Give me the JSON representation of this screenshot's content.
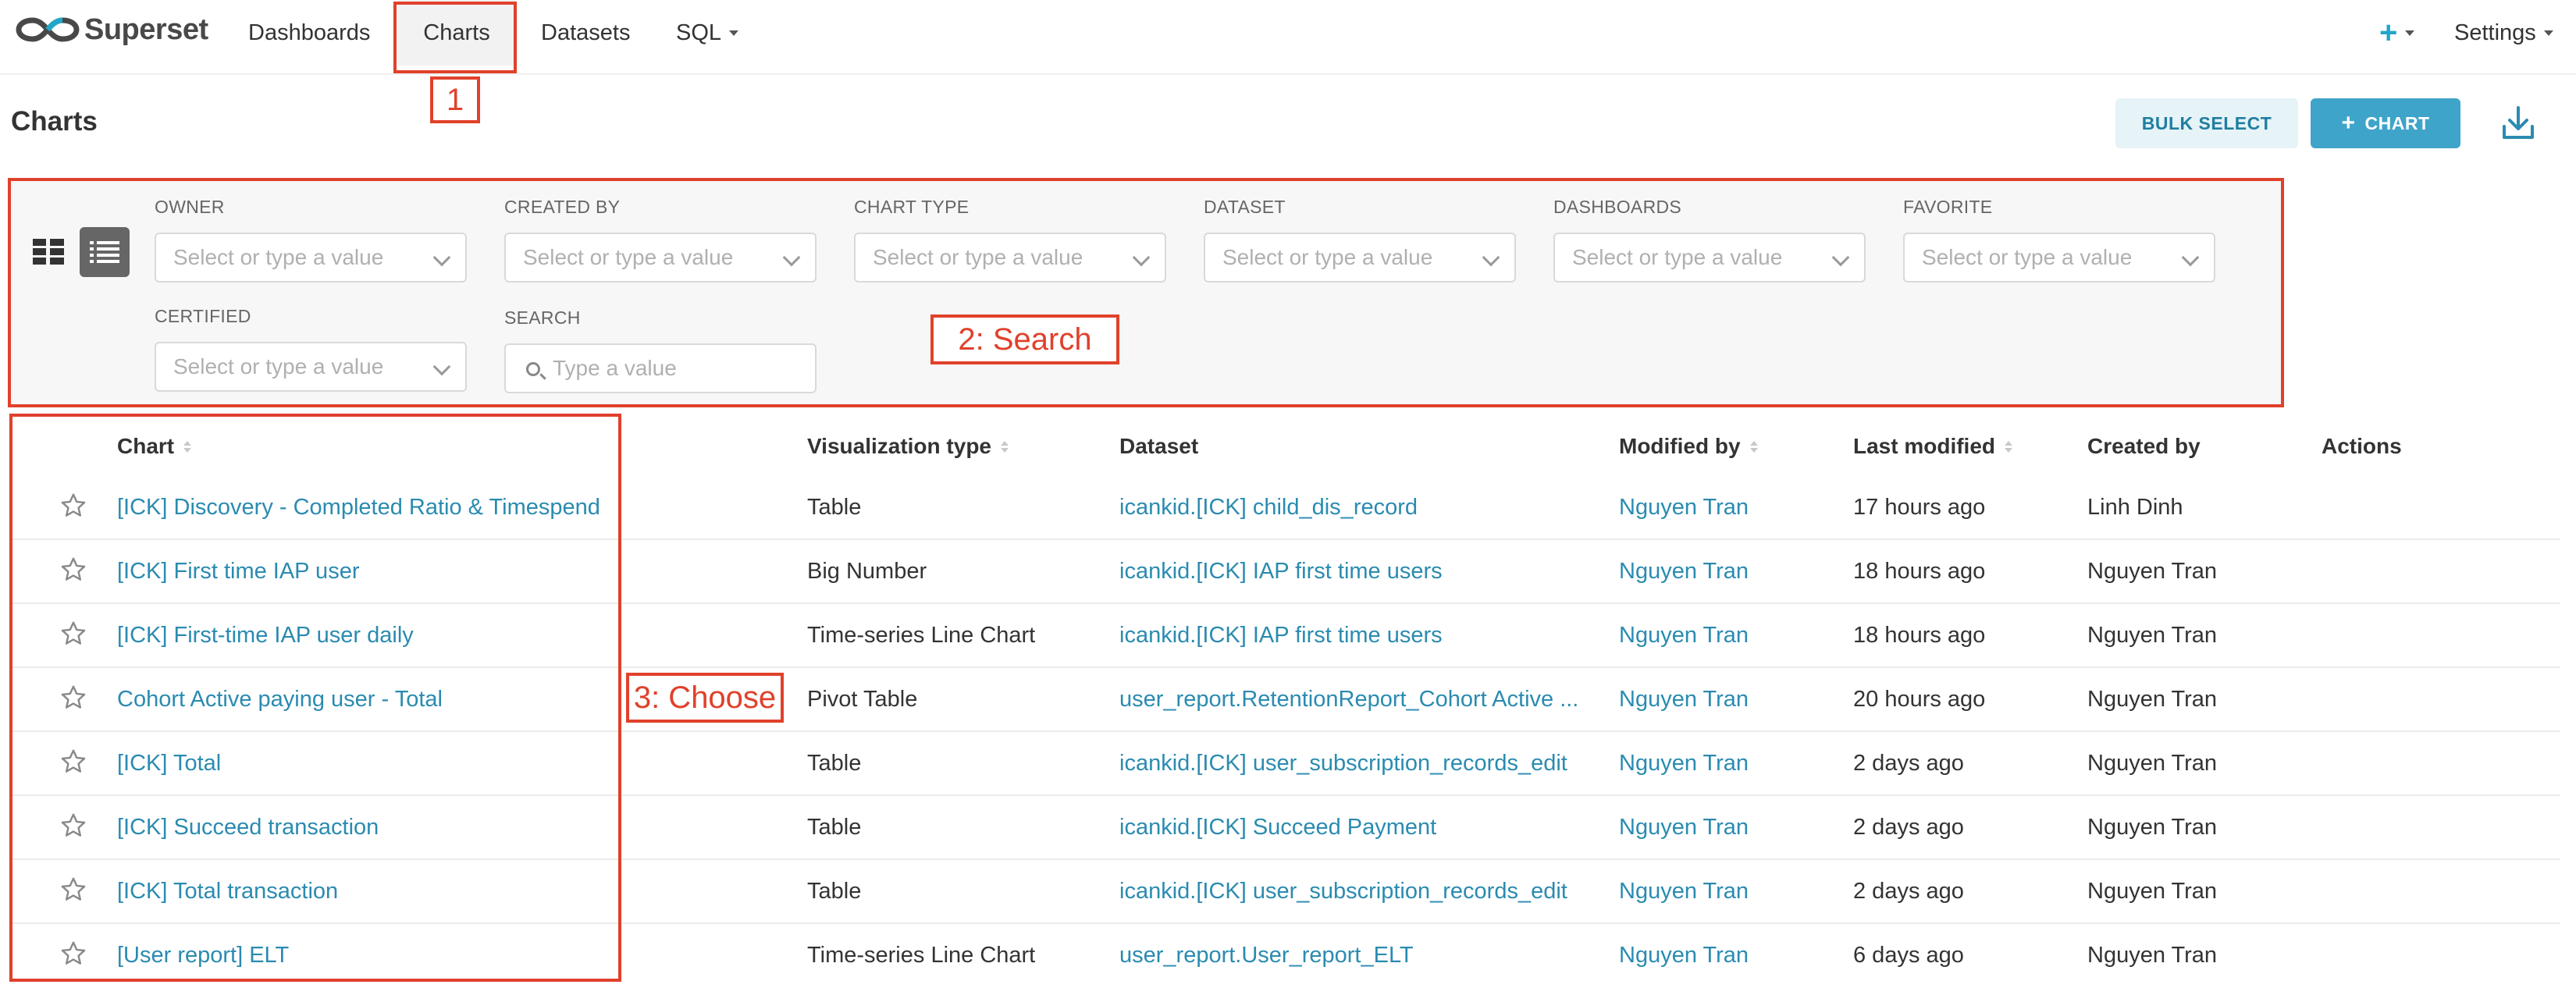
{
  "brand": {
    "name": "Superset"
  },
  "nav": {
    "items": [
      {
        "label": "Dashboards"
      },
      {
        "label": "Charts"
      },
      {
        "label": "Datasets"
      },
      {
        "label": "SQL"
      }
    ],
    "settings_label": "Settings"
  },
  "page": {
    "title": "Charts",
    "bulk_select_label": "BULK SELECT",
    "add_chart_label": "CHART"
  },
  "filters": [
    {
      "label": "OWNER",
      "placeholder": "Select or type a value"
    },
    {
      "label": "CREATED BY",
      "placeholder": "Select or type a value"
    },
    {
      "label": "CHART TYPE",
      "placeholder": "Select or type a value"
    },
    {
      "label": "DATASET",
      "placeholder": "Select or type a value"
    },
    {
      "label": "DASHBOARDS",
      "placeholder": "Select or type a value"
    },
    {
      "label": "FAVORITE",
      "placeholder": "Select or type a value"
    },
    {
      "label": "CERTIFIED",
      "placeholder": "Select or type a value"
    }
  ],
  "search": {
    "label": "SEARCH",
    "placeholder": "Type a value"
  },
  "table": {
    "columns": [
      "Chart",
      "Visualization type",
      "Dataset",
      "Modified by",
      "Last modified",
      "Created by",
      "Actions"
    ],
    "rows": [
      {
        "chart": "[ICK] Discovery - Completed Ratio & Timespend",
        "viz": "Table",
        "dataset": "icankid.[ICK] child_dis_record",
        "modified_by": "Nguyen Tran",
        "last_modified": "17 hours ago",
        "created_by": "Linh Dinh"
      },
      {
        "chart": "[ICK] First time IAP user",
        "viz": "Big Number",
        "dataset": "icankid.[ICK] IAP first time users",
        "modified_by": "Nguyen Tran",
        "last_modified": "18 hours ago",
        "created_by": "Nguyen Tran"
      },
      {
        "chart": "[ICK] First-time IAP user daily",
        "viz": "Time-series Line Chart",
        "dataset": "icankid.[ICK] IAP first time users",
        "modified_by": "Nguyen Tran",
        "last_modified": "18 hours ago",
        "created_by": "Nguyen Tran"
      },
      {
        "chart": "Cohort Active paying user - Total",
        "viz": "Pivot Table",
        "dataset": "user_report.RetentionReport_Cohort Active ...",
        "modified_by": "Nguyen Tran",
        "last_modified": "20 hours ago",
        "created_by": "Nguyen Tran"
      },
      {
        "chart": "[ICK] Total",
        "viz": "Table",
        "dataset": "icankid.[ICK] user_subscription_records_edit",
        "modified_by": "Nguyen Tran",
        "last_modified": "2 days ago",
        "created_by": "Nguyen Tran"
      },
      {
        "chart": "[ICK] Succeed transaction",
        "viz": "Table",
        "dataset": "icankid.[ICK] Succeed Payment",
        "modified_by": "Nguyen Tran",
        "last_modified": "2 days ago",
        "created_by": "Nguyen Tran"
      },
      {
        "chart": "[ICK] Total transaction",
        "viz": "Table",
        "dataset": "icankid.[ICK] user_subscription_records_edit",
        "modified_by": "Nguyen Tran",
        "last_modified": "2 days ago",
        "created_by": "Nguyen Tran"
      },
      {
        "chart": "[User report] ELT",
        "viz": "Time-series Line Chart",
        "dataset": "user_report.User_report_ELT",
        "modified_by": "Nguyen Tran",
        "last_modified": "6 days ago",
        "created_by": "Nguyen Tran"
      }
    ]
  },
  "annotations": {
    "step1": "1",
    "step2": "2: Search",
    "step3": "3: Choose"
  },
  "colors": {
    "accent": "#20a7c9",
    "link": "#2a8bb0",
    "annotation": "#e0412b",
    "primary_button": "#3fa4c9"
  }
}
